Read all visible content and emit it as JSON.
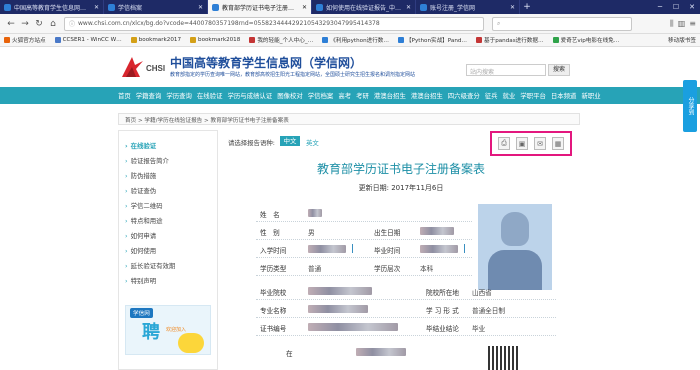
{
  "browser": {
    "tabs": [
      {
        "title": "中国高等教育学生信息网（学信",
        "fav": "#2e7fd6",
        "active": false
      },
      {
        "title": "学信档案",
        "fav": "#2e7fd6",
        "active": false
      },
      {
        "title": "教育部学历证书电子注册备案表",
        "fav": "#2e7fd6",
        "active": true
      },
      {
        "title": "如何使用在线验证报告_中国…",
        "fav": "#2e7fd6",
        "active": false
      },
      {
        "title": "账号注册_学信网",
        "fav": "#2e7fd6",
        "active": false
      }
    ],
    "url": "www.chsi.com.cn/xlcx/bg.do?vcode=4400780357198rnd=055823444429210543293047995414378",
    "search_placeholder": "",
    "bookmarks": [
      {
        "label": "火狐官方站点",
        "color": "#e8630a"
      },
      {
        "label": "CCSER1 - WinCC W…",
        "color": "#4a79c8"
      },
      {
        "label": "bookmark2017",
        "color": "#d4a017"
      },
      {
        "label": "bookmark2018",
        "color": "#d4a017"
      },
      {
        "label": "我的轻能_个人中心_…",
        "color": "#c43535"
      },
      {
        "label": "《利用python进行数…",
        "color": "#2e7fd6"
      },
      {
        "label": "【Python实战】Pand…",
        "color": "#2e7fd6"
      },
      {
        "label": "基于pandas进行数据…",
        "color": "#c43535"
      },
      {
        "label": "爱奇艺vip电影在线免…",
        "color": "#2fa34a"
      }
    ],
    "bookmarks_right": "移动版书签"
  },
  "header": {
    "logo_text": "CHSI",
    "title": "中国高等教育学生信息网（学信网）",
    "subtitle": "教育部指定的学历查询唯一网站，教育部高校招生阳光工程指定网站，全国硕士研究生招生报名和调剂指定网站",
    "search_placeholder": "站内搜索",
    "search_button": "搜索"
  },
  "nav": [
    "首页",
    "学籍查询",
    "学历查询",
    "在线验证",
    "学历与成绩认证",
    "图像校对",
    "学信档案",
    "高考",
    "考研",
    "港澳台招生",
    "港澳台招生",
    "四六级查分",
    "征兵",
    "就业",
    "学职平台",
    "日本频道",
    "新职业"
  ],
  "share_label": "分享到",
  "breadcrumb": "首页 > 学籍/学历在线验证报告 > 教育部学历证书电子注册备案表",
  "sidebar": {
    "items": [
      "在线验证",
      "验证报告简介",
      "防伪措施",
      "验证查伪",
      "学信二维码",
      "特点和用途",
      "如何申请",
      "如何使用",
      "延长验证有效期",
      "特别声明"
    ],
    "banner_tag": "学信网",
    "banner_big": "聘",
    "banner_sub": "欢迎加入"
  },
  "report": {
    "lang_label": "请选择报告语种:",
    "lang_zh": "中文",
    "lang_en": "英文",
    "actions": [
      {
        "name": "print-icon",
        "glyph": "⎙"
      },
      {
        "name": "save-icon",
        "glyph": "▣"
      },
      {
        "name": "mail-icon",
        "glyph": "✉"
      },
      {
        "name": "qrcode-icon",
        "glyph": "▦"
      }
    ],
    "title": "教育部学历证书电子注册备案表",
    "update_label": "更新日期:",
    "update_date": "2017年11月6日",
    "fields": {
      "name_label": "姓　名",
      "gender_label": "性　别",
      "gender_value": "男",
      "birth_label": "出生日期",
      "enroll_label": "入学时间",
      "grad_label": "毕业时间",
      "edu_type_label": "学历类型",
      "edu_type_value": "普通",
      "edu_level_label": "学历层次",
      "edu_level_value": "本科",
      "school_label": "毕业院校",
      "school_loc_label": "院校所在地",
      "school_loc_value": "山西省",
      "major_label": "专业名称",
      "study_form_label": "学 习 形 式",
      "study_form_value": "普通全日制",
      "cert_label": "证书编号",
      "conclusion_label": "毕结业结论",
      "conclusion_value": "毕业",
      "bottom_label": "在"
    }
  }
}
